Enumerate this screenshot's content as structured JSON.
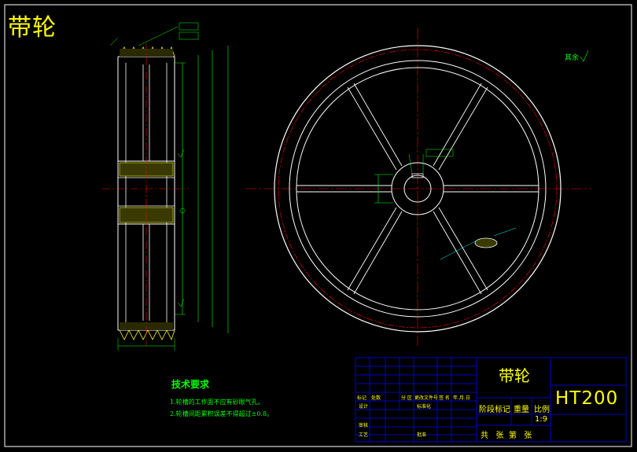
{
  "drawing": {
    "title": "带轮",
    "roughness_note": "其余"
  },
  "technical_requirements": {
    "heading": "技术要求",
    "items": [
      "1.轮槽的工作面不应有砂眼气孔。",
      "2.轮槽间距累积误差不得超过±0.8。"
    ]
  },
  "title_block": {
    "part_name": "带轮",
    "material": "HT200",
    "scale": "1:9",
    "headers": {
      "mark": "标记",
      "count": "处数",
      "zone": "分 区",
      "change_doc": "更改文件号",
      "signature": "签 名",
      "date": "年.月.日"
    },
    "rows": {
      "design": "设计",
      "standardization": "标准化",
      "review": "审核",
      "process": "工艺",
      "approve": "批准"
    },
    "stage_mark": "阶段标记",
    "weight": "重量",
    "scale_label": "比例",
    "sheets": "共   张  第   张"
  },
  "colors": {
    "background": "#000000",
    "outline": "#ffffff",
    "dimension": "#00ff00",
    "centerline": "#ff0000",
    "hatch": "#ffff00",
    "table_grid": "#0000ff",
    "label": "#ffff00"
  }
}
